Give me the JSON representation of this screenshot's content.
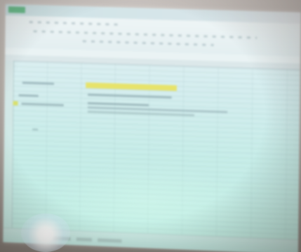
{
  "scene": {
    "description_free": true,
    "screen_color": "#c8ede9",
    "highlight_color": "#e7e36a",
    "accent_color": "#6cbf8e"
  }
}
